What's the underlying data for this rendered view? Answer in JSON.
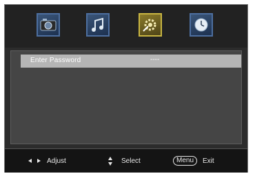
{
  "icons": [
    {
      "name": "picture-icon",
      "active": false
    },
    {
      "name": "sound-icon",
      "active": false
    },
    {
      "name": "setup-icon",
      "active": true
    },
    {
      "name": "time-icon",
      "active": false
    }
  ],
  "menu": {
    "rows": [
      {
        "label": "Enter Password",
        "value": "----"
      }
    ]
  },
  "footer": {
    "adjust_label": "Adjust",
    "select_label": "Select",
    "menu_key": "Menu",
    "exit_label": "Exit"
  },
  "colors": {
    "highlight_row": "#b5b5b5",
    "active_icon_border": "#c9b642",
    "icon_border": "#4d6fa0"
  }
}
